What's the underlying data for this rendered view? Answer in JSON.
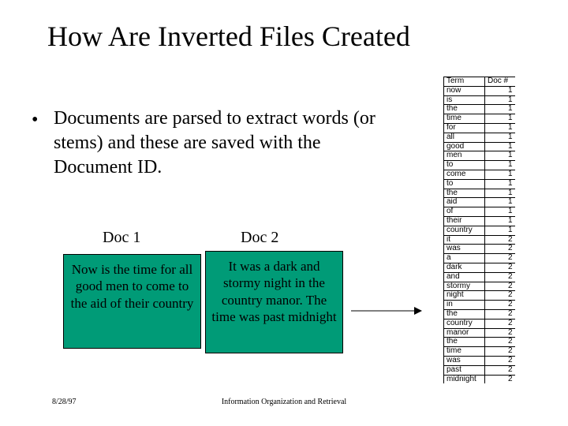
{
  "title": "How Are Inverted Files Created",
  "bullet": "Documents are parsed to extract words (or stems) and these are saved with the Document ID.",
  "doc1": {
    "label": "Doc 1",
    "text": "Now is the time for all good men to come to the aid of their country"
  },
  "doc2": {
    "label": "Doc 2",
    "text": "It was a dark and stormy night in the country manor. The time was past midnight"
  },
  "table": {
    "header": {
      "term": "Term",
      "doc": "Doc #"
    },
    "rows": [
      {
        "term": "now",
        "doc": "1"
      },
      {
        "term": "is",
        "doc": "1"
      },
      {
        "term": "the",
        "doc": "1"
      },
      {
        "term": "time",
        "doc": "1"
      },
      {
        "term": "for",
        "doc": "1"
      },
      {
        "term": "all",
        "doc": "1"
      },
      {
        "term": "good",
        "doc": "1"
      },
      {
        "term": "men",
        "doc": "1"
      },
      {
        "term": "to",
        "doc": "1"
      },
      {
        "term": "come",
        "doc": "1"
      },
      {
        "term": "to",
        "doc": "1"
      },
      {
        "term": "the",
        "doc": "1"
      },
      {
        "term": "aid",
        "doc": "1"
      },
      {
        "term": "of",
        "doc": "1"
      },
      {
        "term": "their",
        "doc": "1"
      },
      {
        "term": "country",
        "doc": "1"
      },
      {
        "term": "it",
        "doc": "2"
      },
      {
        "term": "was",
        "doc": "2"
      },
      {
        "term": "a",
        "doc": "2"
      },
      {
        "term": "dark",
        "doc": "2"
      },
      {
        "term": "and",
        "doc": "2"
      },
      {
        "term": "stormy",
        "doc": "2"
      },
      {
        "term": "night",
        "doc": "2"
      },
      {
        "term": "in",
        "doc": "2"
      },
      {
        "term": "the",
        "doc": "2"
      },
      {
        "term": "country",
        "doc": "2"
      },
      {
        "term": "manor",
        "doc": "2"
      },
      {
        "term": "the",
        "doc": "2"
      },
      {
        "term": "time",
        "doc": "2"
      },
      {
        "term": "was",
        "doc": "2"
      },
      {
        "term": "past",
        "doc": "2"
      },
      {
        "term": "midnight",
        "doc": "2"
      }
    ]
  },
  "footer": {
    "date": "8/28/97",
    "center": "Information Organization and Retrieval"
  }
}
